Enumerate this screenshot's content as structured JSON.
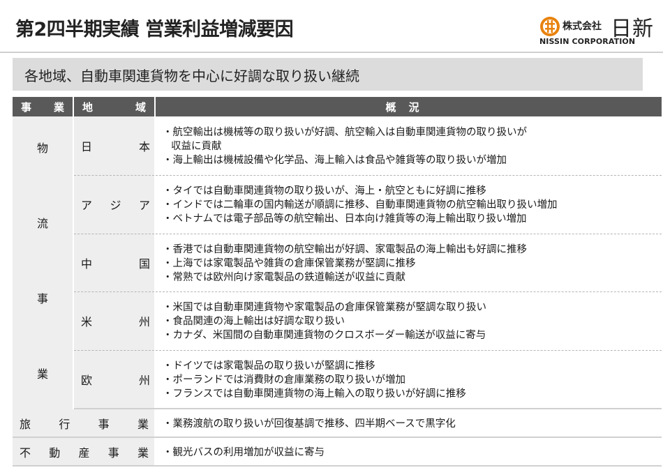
{
  "header": {
    "title": "第2四半期実績 営業利益増減要因",
    "logo_kabushiki": "株式会社",
    "logo_name": "日新",
    "logo_en": "NISSIN CORPORATION",
    "brand_color": "#e8820e"
  },
  "subtitle": "各地域、自動車関連貨物を中心に好調な取り扱い継続",
  "table": {
    "headers": {
      "business": [
        "事",
        "業"
      ],
      "region": [
        "地",
        "域"
      ],
      "summary": "概況"
    },
    "logistics_label": [
      "物",
      "流",
      "事",
      "業"
    ],
    "regions": [
      {
        "name": [
          "日",
          "本"
        ],
        "lines": [
          "・航空輸出は機械等の取り扱いが好調、航空輸入は自動車関連貨物の取り扱いが",
          "収益に貢献",
          "・海上輸出は機械設備や化学品、海上輸入は食品や雑貨等の取り扱いが増加"
        ]
      },
      {
        "name": [
          "ア",
          "ジ",
          "ア"
        ],
        "lines": [
          "・タイでは自動車関連貨物の取り扱いが、海上・航空ともに好調に推移",
          "・インドでは二輪車の国内輸送が順調に推移、自動車関連貨物の航空輸出取り扱い増加",
          "・ベトナムでは電子部品等の航空輸出、日本向け雑貨等の海上輸出取り扱い増加"
        ]
      },
      {
        "name": [
          "中",
          "国"
        ],
        "lines": [
          "・香港では自動車関連貨物の航空輸出が好調、家電製品の海上輸出も好調に推移",
          "・上海では家電製品や雑貨の倉庫保管業務が堅調に推移",
          "・常熟では欧州向け家電製品の鉄道輸送が収益に貢献"
        ]
      },
      {
        "name": [
          "米",
          "州"
        ],
        "lines": [
          "・米国では自動車関連貨物や家電製品の倉庫保管業務が堅調な取り扱い",
          "・食品関連の海上輸出は好調な取り扱い",
          "・カナダ、米国間の自動車関連貨物のクロスボーダー輸送が収益に寄与"
        ]
      },
      {
        "name": [
          "欧",
          "州"
        ],
        "lines": [
          "・ドイツでは家電製品の取り扱いが堅調に推移",
          "・ポーランドでは消費財の倉庫業務の取り扱いが増加",
          "・フランスでは自動車関連貨物の海上輸入の取り扱いが好調に推移"
        ]
      }
    ],
    "travel": {
      "label": [
        "旅",
        "行",
        "事",
        "業"
      ],
      "line": "・業務渡航の取り扱いが回復基調で推移、四半期ベースで黒字化"
    },
    "realestate": {
      "label": [
        "不",
        "動",
        "産",
        "事",
        "業"
      ],
      "line": "・観光バスの利用増加が収益に寄与"
    }
  }
}
